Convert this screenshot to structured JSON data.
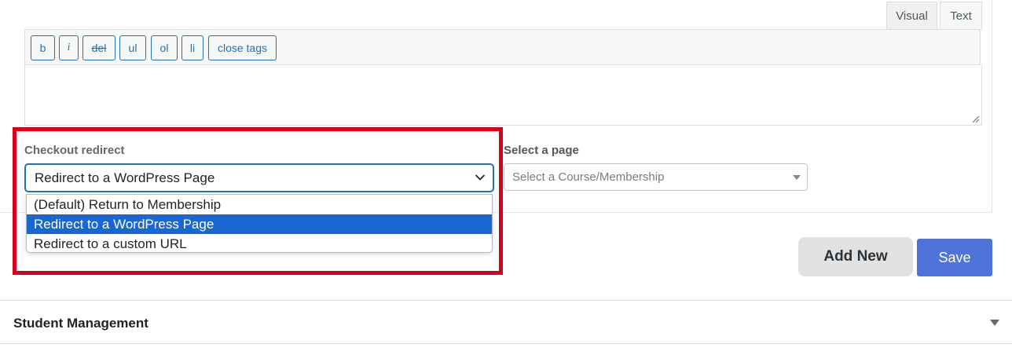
{
  "editor": {
    "tabs": [
      {
        "label": "Visual"
      },
      {
        "label": "Text"
      }
    ],
    "quicktags": [
      {
        "label": "b"
      },
      {
        "label": "i"
      },
      {
        "label": "del"
      },
      {
        "label": "ul"
      },
      {
        "label": "ol"
      },
      {
        "label": "li"
      },
      {
        "label": "close tags"
      }
    ]
  },
  "checkout_redirect": {
    "label": "Checkout redirect",
    "selected": "Redirect to a WordPress Page",
    "options": [
      {
        "label": "(Default) Return to Membership",
        "selected": false
      },
      {
        "label": "Redirect to a WordPress Page",
        "selected": true
      },
      {
        "label": "Redirect to a custom URL",
        "selected": false
      }
    ]
  },
  "page_select": {
    "label": "Select a page",
    "placeholder": "Select a Course/Membership"
  },
  "actions": {
    "add_new": "Add New",
    "save": "Save"
  },
  "sections": [
    {
      "title": "Student Management"
    }
  ],
  "colors": {
    "accent": "#2271b1",
    "option_highlight": "#1967d2",
    "callout_border": "#d6001c",
    "save_button": "#4f74d9"
  }
}
